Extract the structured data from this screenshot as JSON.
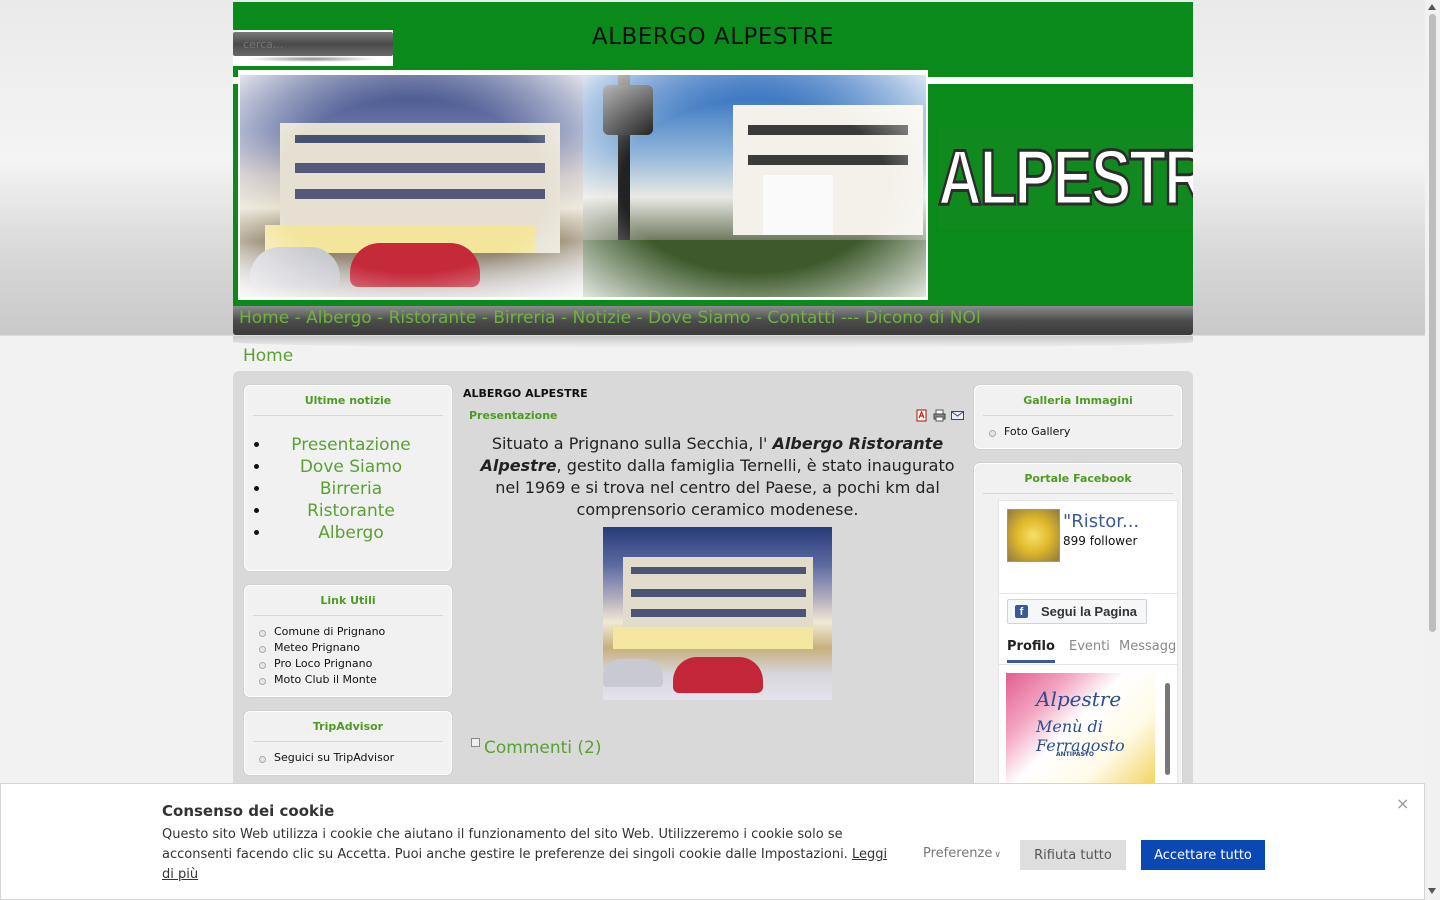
{
  "header": {
    "site_title": "ALBERGO ALPESTRE",
    "search_placeholder": "cerca...",
    "logo_text": "ALPESTRE"
  },
  "nav": {
    "text": "Home - Albergo - Ristorante - Birreria - Notizie - Dove Siamo - Contatti --- Dicono di NOI"
  },
  "breadcrumb": "Home",
  "left_modules": {
    "news": {
      "title": "Ultime notizie",
      "items": [
        "Presentazione",
        "Dove Siamo",
        "Birreria",
        "Ristorante",
        "Albergo"
      ]
    },
    "links": {
      "title": "Link Utili",
      "items": [
        "Comune di Prignano",
        "Meteo Prignano",
        "Pro Loco Prignano",
        "Moto Club il Monte"
      ]
    },
    "tripadvisor": {
      "title": "TripAdvisor",
      "items": [
        "Seguici su TripAdvisor"
      ]
    }
  },
  "article": {
    "title": "ALBERGO ALPESTRE",
    "subtitle": "Presentazione",
    "body_before": "Situato a Prignano sulla Secchia, l' ",
    "body_bold": "Albergo Ristorante Alpestre",
    "body_after": ", gestito dalla famiglia Ternelli, è stato inaugurato nel 1969 e si trova nel centro del Paese, a pochi km dal comprensorio ceramico modenese.",
    "comments": "Commenti (2)",
    "icons": [
      "pdf-icon",
      "print-icon",
      "email-icon"
    ]
  },
  "right_modules": {
    "gallery": {
      "title": "Galleria Immagini",
      "items": [
        "Foto Gallery"
      ]
    },
    "facebook": {
      "title": "Portale Facebook",
      "page_name": "\"Ristor...",
      "followers": "899 follower",
      "follow_button": "Segui la Pagina",
      "tabs": [
        "Profilo",
        "Eventi",
        "Messaggi"
      ],
      "post": {
        "brand": "Alpestre",
        "title": "Menù di Ferragosto",
        "section_label": "ANTIPASTO"
      }
    }
  },
  "cookie": {
    "title": "Consenso dei cookie",
    "text": "Questo sito Web utilizza i cookie che aiutano il funzionamento del sito Web. Utilizzeremo i cookie solo se acconsenti facendo clic su Accetta. Puoi anche gestire le preferenze dei singoli cookie dalle Impostazioni.",
    "link": "Leggi di più",
    "preferences": "Preferenze",
    "reject": "Rifiuta tutto",
    "accept": "Accettare tutto",
    "close": "×"
  },
  "colors": {
    "header_green": "#0b8a1c",
    "link_green": "#5aa132",
    "accept_blue": "#0a48b3"
  }
}
